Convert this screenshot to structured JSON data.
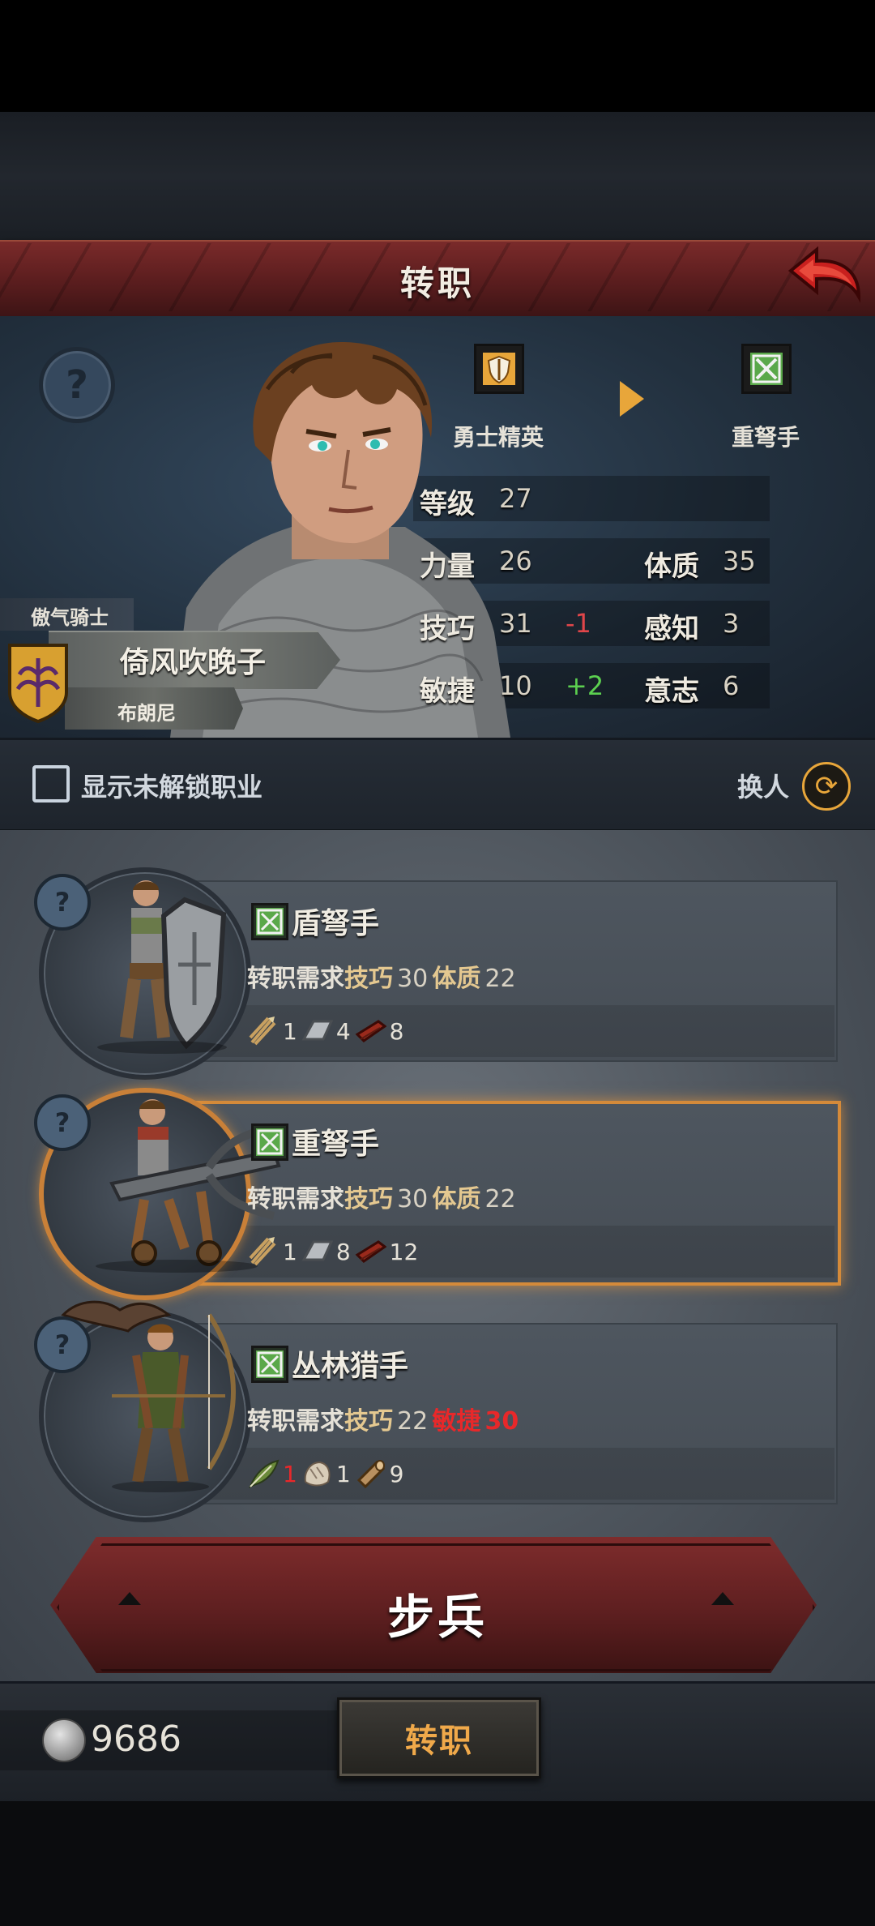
{
  "header": {
    "title": "转职",
    "back_icon": "back-arrow-icon"
  },
  "character": {
    "title": "傲气骑士",
    "name": "倚风吹晚子",
    "origin": "布朗尼",
    "class_from": "勇士精英",
    "class_to": "重弩手",
    "stats": {
      "level_label": "等级",
      "level": "27",
      "str_label": "力量",
      "str": "26",
      "con_label": "体质",
      "con": "35",
      "skill_label": "技巧",
      "skill": "31",
      "skill_mod": "-1",
      "per_label": "感知",
      "per": "3",
      "agi_label": "敏捷",
      "agi": "10",
      "agi_mod": "+2",
      "will_label": "意志",
      "will": "6"
    }
  },
  "filter": {
    "show_locked_label": "显示未解锁职业",
    "checked": false,
    "swap_label": "换人"
  },
  "classes": [
    {
      "name": "盾弩手",
      "req_prefix": "转职需求",
      "req1_stat": "技巧",
      "req1_val": "30",
      "req2_stat": "体质",
      "req2_val": "22",
      "materials": [
        {
          "icon": "bolts-icon",
          "count": "1"
        },
        {
          "icon": "iron-ingot-icon",
          "count": "4"
        },
        {
          "icon": "wood-plank-icon",
          "count": "8"
        }
      ],
      "selected": false
    },
    {
      "name": "重弩手",
      "req_prefix": "转职需求",
      "req1_stat": "技巧",
      "req1_val": "30",
      "req2_stat": "体质",
      "req2_val": "22",
      "materials": [
        {
          "icon": "bolts-icon",
          "count": "1"
        },
        {
          "icon": "iron-ingot-icon",
          "count": "8"
        },
        {
          "icon": "wood-plank-icon",
          "count": "12"
        }
      ],
      "selected": true
    },
    {
      "name": "丛林猎手",
      "req_prefix": "转职需求",
      "req1_stat": "技巧",
      "req1_val": "22",
      "req2_stat": "敏捷",
      "req2_val": "30",
      "materials": [
        {
          "icon": "feather-icon",
          "count": "1"
        },
        {
          "icon": "fur-icon",
          "count": "1"
        },
        {
          "icon": "log-icon",
          "count": "9"
        }
      ],
      "selected": false
    }
  ],
  "category": {
    "label": "步兵"
  },
  "footer": {
    "coins": "9686",
    "convert_label": "转职"
  },
  "colors": {
    "accent": "#e8a63a",
    "header_red": "#6a2324",
    "negative": "#e0464a",
    "positive": "#5cd050",
    "requirement_fail": "#e8282a"
  }
}
